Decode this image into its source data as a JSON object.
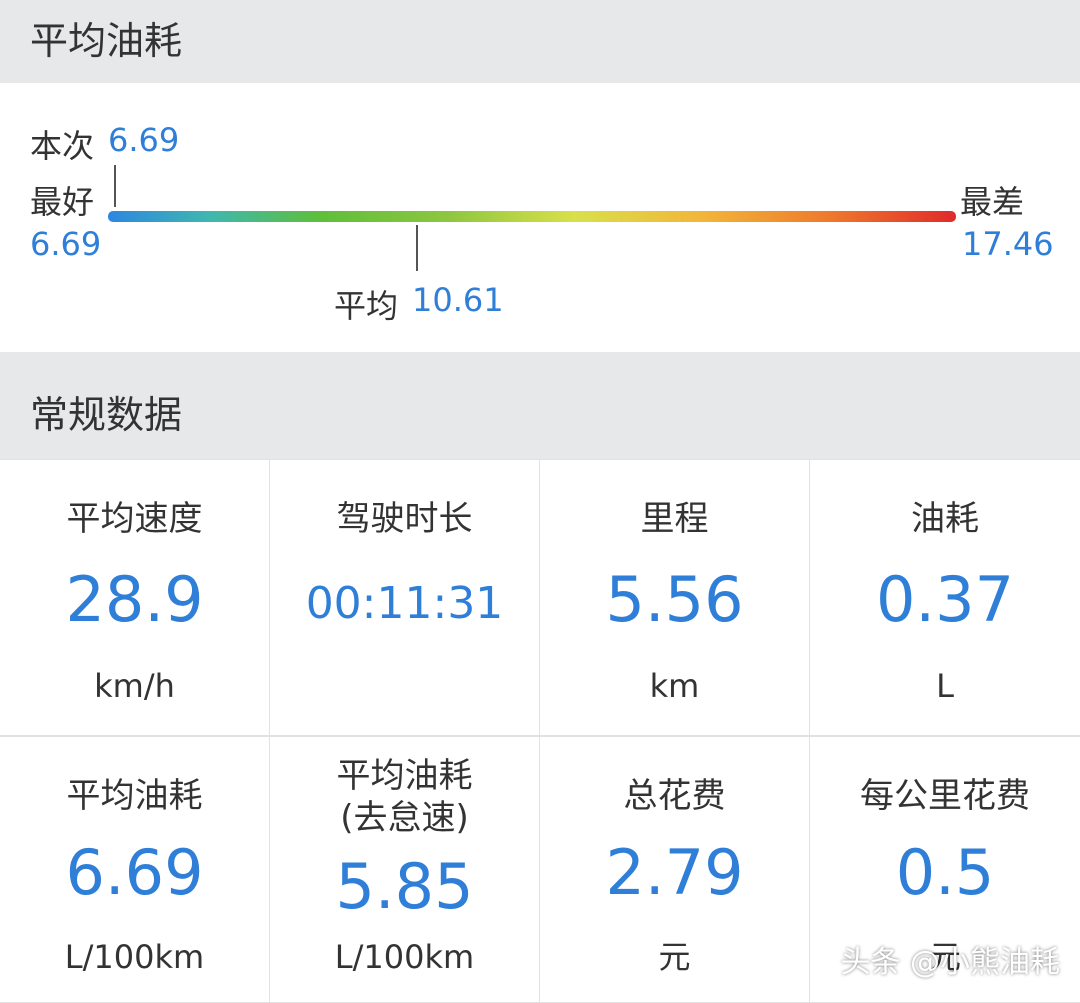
{
  "section1": {
    "title": "平均油耗"
  },
  "gauge": {
    "current_label": "本次",
    "current_value": "6.69",
    "best_label": "最好",
    "best_value": "6.69",
    "worst_label": "最差",
    "worst_value": "17.46",
    "avg_label": "平均",
    "avg_value": "10.61",
    "colors": [
      "#2e86e0",
      "#5ebf3a",
      "#d9e04a",
      "#f2b63a",
      "#e02a2a"
    ]
  },
  "section2": {
    "title": "常规数据"
  },
  "stats": [
    {
      "label": "平均速度",
      "value": "28.9",
      "unit": "km/h"
    },
    {
      "label": "驾驶时长",
      "value": "00:11:31",
      "unit": ""
    },
    {
      "label": "里程",
      "value": "5.56",
      "unit": "km"
    },
    {
      "label": "油耗",
      "value": "0.37",
      "unit": "L"
    },
    {
      "label": "平均油耗",
      "value": "6.69",
      "unit": "L/100km"
    },
    {
      "label": "平均油耗\n(去怠速)",
      "value": "5.85",
      "unit": "L/100km"
    },
    {
      "label": "总花费",
      "value": "2.79",
      "unit": "元"
    },
    {
      "label": "每公里花费",
      "value": "0.5",
      "unit": "元"
    }
  ],
  "watermark": "头条 @小熊油耗",
  "accent_color": "#2f7fd8"
}
